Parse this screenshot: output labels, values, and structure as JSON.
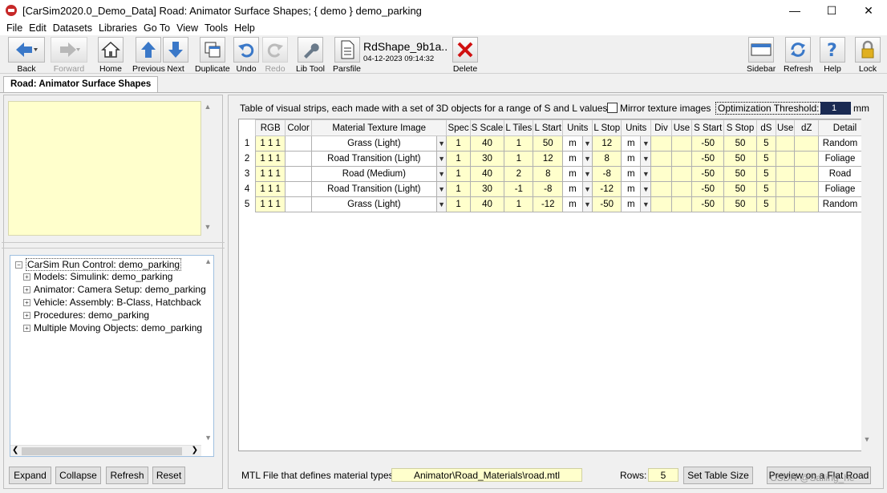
{
  "window": {
    "title": "[CarSim2020.0_Demo_Data] Road: Animator Surface Shapes; { demo } demo_parking",
    "minimize": "—",
    "maximize": "☐",
    "close": "✕"
  },
  "menu": [
    "File",
    "Edit",
    "Datasets",
    "Libraries",
    "Go To",
    "View",
    "Tools",
    "Help"
  ],
  "toolbar": {
    "back": "Back",
    "forward": "Forward",
    "home": "Home",
    "previous": "Previous",
    "next": "Next",
    "duplicate": "Duplicate",
    "undo": "Undo",
    "redo": "Redo",
    "libtool": "Lib Tool",
    "parsfile": "Parsfile",
    "dataset_name": "RdShape_9b1a..",
    "dataset_date": "04-12-2023 09:14:32",
    "delete": "Delete",
    "sidebar": "Sidebar",
    "refresh": "Refresh",
    "help": "Help",
    "lock": "Lock"
  },
  "panel_tab": "Road: Animator Surface Shapes",
  "tree": {
    "root": "CarSim Run Control: demo_parking",
    "items": [
      "Models: Simulink: demo_parking",
      "Animator: Camera Setup: demo_parking",
      "Vehicle: Assembly: B-Class, Hatchback",
      "Procedures: demo_parking",
      "Multiple Moving Objects: demo_parking"
    ]
  },
  "left_buttons": {
    "expand": "Expand",
    "collapse": "Collapse",
    "refresh": "Refresh",
    "reset": "Reset"
  },
  "right": {
    "description": "Table of visual strips, each made with a set of 3D objects for a range of S and L values",
    "mirror_label": "Mirror texture images",
    "opt_label": "Optimization Threshold:",
    "opt_value": "1",
    "opt_unit": "mm",
    "mtl_label": "MTL File that defines material types:",
    "mtl_value": "Animator\\Road_Materials\\road.mtl",
    "rows_label": "Rows:",
    "rows_value": "5",
    "set_table_size": "Set Table Size",
    "preview": "Preview on a Flat Road"
  },
  "table": {
    "headers": [
      "RGB",
      "Color",
      "Material Texture Image",
      "Spec",
      "S Scale",
      "L Tiles",
      "L Start",
      "Units",
      "L Stop",
      "Units",
      "Div",
      "Use",
      "S Start",
      "S Stop",
      "dS",
      "Use",
      "dZ",
      "Detail"
    ],
    "rows": [
      {
        "n": "1",
        "rgb": "1 1 1",
        "mat": "Grass (Light)",
        "spec": "1",
        "sscale": "40",
        "ltiles": "1",
        "lstart": "50",
        "u1": "m",
        "lstop": "12",
        "u2": "m",
        "sstart": "-50",
        "sstop": "50",
        "ds": "5",
        "detail": "Random"
      },
      {
        "n": "2",
        "rgb": "1 1 1",
        "mat": "Road Transition (Light)",
        "spec": "1",
        "sscale": "30",
        "ltiles": "1",
        "lstart": "12",
        "u1": "m",
        "lstop": "8",
        "u2": "m",
        "sstart": "-50",
        "sstop": "50",
        "ds": "5",
        "detail": "Foliage"
      },
      {
        "n": "3",
        "rgb": "1 1 1",
        "mat": "Road (Medium)",
        "spec": "1",
        "sscale": "40",
        "ltiles": "2",
        "lstart": "8",
        "u1": "m",
        "lstop": "-8",
        "u2": "m",
        "sstart": "-50",
        "sstop": "50",
        "ds": "5",
        "detail": "Road"
      },
      {
        "n": "4",
        "rgb": "1 1 1",
        "mat": "Road Transition (Light)",
        "spec": "1",
        "sscale": "30",
        "ltiles": "-1",
        "lstart": "-8",
        "u1": "m",
        "lstop": "-12",
        "u2": "m",
        "sstart": "-50",
        "sstop": "50",
        "ds": "5",
        "detail": "Foliage"
      },
      {
        "n": "5",
        "rgb": "1 1 1",
        "mat": "Grass (Light)",
        "spec": "1",
        "sscale": "40",
        "ltiles": "1",
        "lstart": "-12",
        "u1": "m",
        "lstop": "-50",
        "u2": "m",
        "sstart": "-50",
        "sstop": "50",
        "ds": "5",
        "detail": "Random"
      }
    ]
  },
  "watermark": "CSDN @Sailing_he"
}
